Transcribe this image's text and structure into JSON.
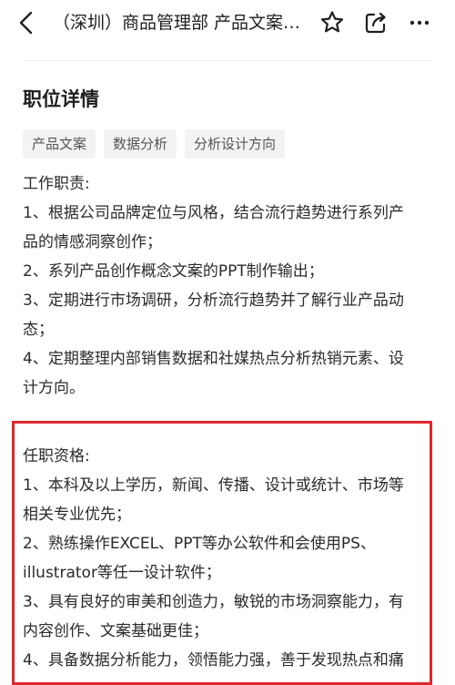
{
  "nav": {
    "title": "（深圳）商品管理部 产品文案…",
    "icons": [
      "back-arrow-icon",
      "star-icon",
      "share-icon",
      "more-icon"
    ]
  },
  "section": {
    "title": "职位详情"
  },
  "tags": [
    "产品文案",
    "数据分析",
    "分析设计方向"
  ],
  "duties": {
    "heading": "工作职责:",
    "lines": [
      "1、根据公司品牌定位与风格，结合流行趋势进行系列产",
      "品的情感洞察创作；",
      "2、系列产品创作概念文案的PPT制作输出；",
      "3、定期进行市场调研，分析流行趋势并了解行业产品动",
      "态；",
      "4、定期整理内部销售数据和社媒热点分析热销元素、设",
      "计方向。"
    ]
  },
  "requirements": {
    "heading": "任职资格:",
    "lines": [
      "1、本科及以上学历，新闻、传播、设计或统计、市场等",
      "相关专业优先；",
      "2、熟练操作EXCEL、PPT等办公软件和会使用PS、",
      "illustrator等任一设计软件；",
      "3、具有良好的审美和创造力，敏锐的市场洞察能力，有",
      "内容创作、文案基础更佳；",
      "4、具备数据分析能力，领悟能力强，善于发现热点和痛"
    ]
  },
  "colors": {
    "highlight_border": "#e0262d",
    "tag_bg": "#f3f3f3",
    "text": "#2b2b2b"
  }
}
